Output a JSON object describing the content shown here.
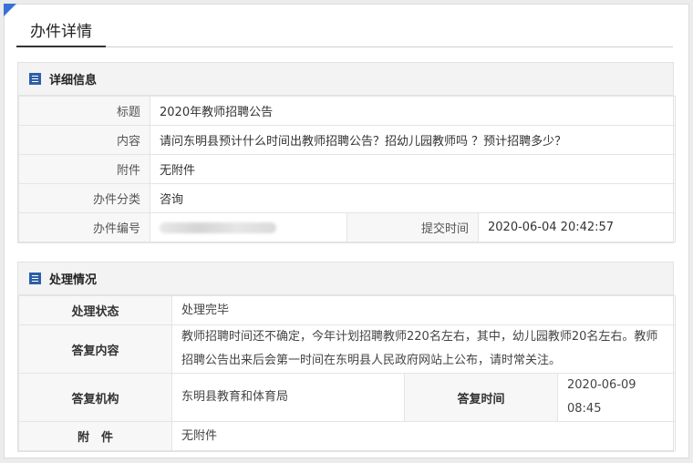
{
  "page": {
    "title": "办件详情"
  },
  "detail": {
    "title": "详细信息",
    "rows": {
      "subject_label": "标题",
      "subject": "2020年教师招聘公告",
      "content_label": "内容",
      "content": "请问东明县预计什么时间出教师招聘公告？招幼儿园教师吗 ？预计招聘多少？",
      "attach_label": "附件",
      "attach": "无附件",
      "category_label": "办件分类",
      "category": "咨询",
      "number_label": "办件编号",
      "number": "",
      "submit_time_label": "提交时间",
      "submit_time": "2020-06-04 20:42:57"
    }
  },
  "handling": {
    "title": "处理情况",
    "rows": {
      "status_label": "处理状态",
      "status": "处理完毕",
      "reply_label": "答复内容",
      "reply": "教师招聘时间还不确定，今年计划招聘教师220名左右，其中，幼儿园教师20名左右。教师招聘公告出来后会第一时间在东明县人民政府网站上公布，请时常关注。",
      "org_label": "答复机构",
      "org": "东明县教育和体育局",
      "reply_time_label": "答复时间",
      "reply_time": "2020-06-09 08:45",
      "attach_label": "附　件",
      "attach": "无附件"
    }
  },
  "colors": {
    "accent": "#3a6fd8",
    "icon": "#2d5fa8"
  },
  "icons": {
    "section": "document-list-icon",
    "corner": "corner-triangle-icon"
  }
}
